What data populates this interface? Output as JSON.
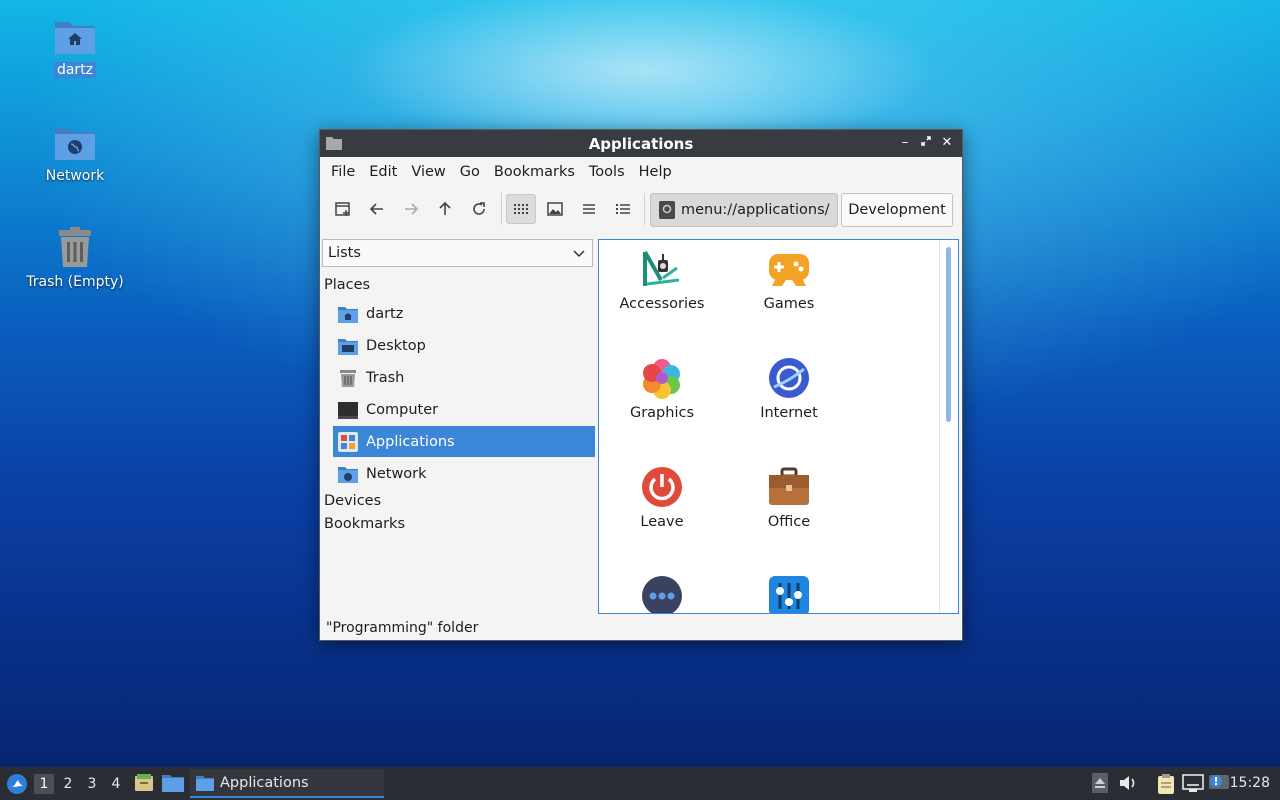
{
  "desktop": {
    "icons": [
      {
        "label": "dartz",
        "icon": "home-folder-icon"
      },
      {
        "label": "Network",
        "icon": "network-folder-icon"
      },
      {
        "label": "Trash (Empty)",
        "icon": "trash-icon"
      }
    ]
  },
  "window": {
    "title": "Applications",
    "menu": [
      "File",
      "Edit",
      "View",
      "Go",
      "Bookmarks",
      "Tools",
      "Help"
    ],
    "location": "menu://applications/",
    "breadcrumb": "Development",
    "sidebar": {
      "mode": "Lists",
      "places_heading": "Places",
      "places": [
        {
          "label": "dartz",
          "icon": "home-folder-icon"
        },
        {
          "label": "Desktop",
          "icon": "desktop-folder-icon"
        },
        {
          "label": "Trash",
          "icon": "trash-icon"
        },
        {
          "label": "Computer",
          "icon": "computer-icon"
        },
        {
          "label": "Applications",
          "icon": "applications-icon",
          "selected": true
        },
        {
          "label": "Network",
          "icon": "network-folder-icon"
        }
      ],
      "devices_heading": "Devices",
      "bookmarks_heading": "Bookmarks"
    },
    "apps": [
      {
        "label": "Accessories",
        "icon": "accessories-icon"
      },
      {
        "label": "Games",
        "icon": "games-icon"
      },
      {
        "label": "Graphics",
        "icon": "graphics-icon"
      },
      {
        "label": "Internet",
        "icon": "internet-icon"
      },
      {
        "label": "Leave",
        "icon": "power-icon"
      },
      {
        "label": "Office",
        "icon": "office-briefcase-icon"
      },
      {
        "label": "",
        "icon": "other-dots-icon"
      },
      {
        "label": "",
        "icon": "preferences-icon"
      }
    ],
    "status": "\"Programming\" folder"
  },
  "taskbar": {
    "workspaces": [
      "1",
      "2",
      "3",
      "4"
    ],
    "active_workspace": "1",
    "task_label": "Applications",
    "clock": "15:28"
  },
  "colors": {
    "accent": "#3c86d8",
    "titlebar": "#383c42",
    "taskbar": "#2a2d33"
  }
}
